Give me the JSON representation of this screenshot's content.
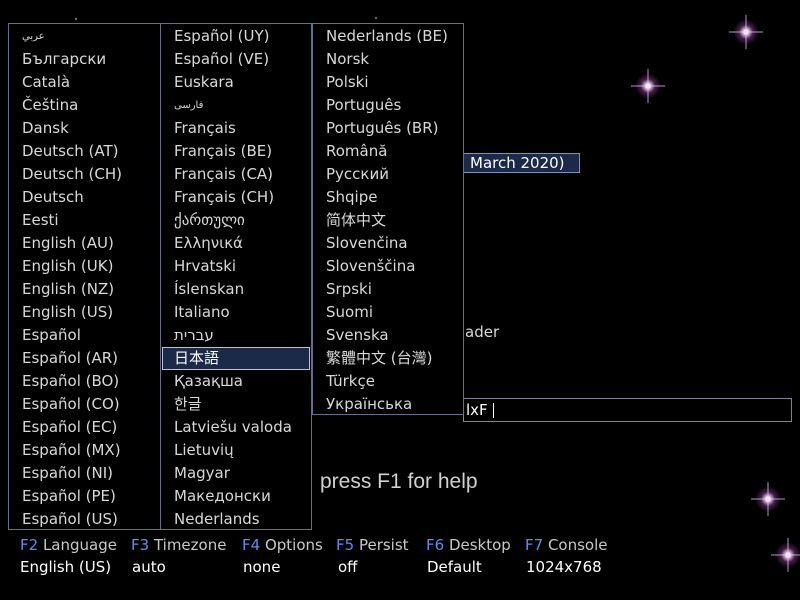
{
  "background": {
    "version_text": "March 2020)",
    "loader_fragment": "ader",
    "boot_options_fragment": "lxF",
    "help_text": "press F1 for help"
  },
  "language_menu": {
    "columns": [
      [
        "عربي",
        "Български",
        "Català",
        "Čeština",
        "Dansk",
        "Deutsch (AT)",
        "Deutsch (CH)",
        "Deutsch",
        "Eesti",
        "English (AU)",
        "English (UK)",
        "English (NZ)",
        "English (US)",
        "Español",
        "Español (AR)",
        "Español (BO)",
        "Español (CO)",
        "Español (EC)",
        "Español (MX)",
        "Español (NI)",
        "Español (PE)",
        "Español (US)"
      ],
      [
        "Español (UY)",
        "Español (VE)",
        "Euskara",
        "فارسی",
        "Français",
        "Français (BE)",
        "Français (CA)",
        "Français (CH)",
        "ქართული",
        "Ελληνικά",
        "Hrvatski",
        "Íslenskan",
        "Italiano",
        "עברית",
        "日本語",
        "Қазақша",
        "한글",
        "Latviešu valoda",
        "Lietuvių",
        "Magyar",
        "Македонски",
        "Nederlands"
      ],
      [
        "Nederlands (BE)",
        "Norsk",
        "Polski",
        "Português",
        "Português (BR)",
        "Română",
        "Русский",
        "Shqipe",
        "简体中文",
        "Slovenčina",
        "Slovenščina",
        "Srpski",
        "Suomi",
        "Svenska",
        "繁體中文 (台灣)",
        "Türkçe",
        "Українська"
      ]
    ],
    "selected": "日本語"
  },
  "function_keys": [
    {
      "key": "F2",
      "label": "Language",
      "value": "English (US)"
    },
    {
      "key": "F3",
      "label": "Timezone",
      "value": "auto"
    },
    {
      "key": "F4",
      "label": "Options",
      "value": "none"
    },
    {
      "key": "F5",
      "label": "Persist",
      "value": "off"
    },
    {
      "key": "F6",
      "label": "Desktop",
      "value": "Default"
    },
    {
      "key": "F7",
      "label": "Console",
      "value": "1024x768"
    }
  ],
  "colors": {
    "background": "#000000",
    "menu_border": "#5e6f96",
    "selection_bg": "#1b2a48",
    "fkey_accent": "#5b8ef0"
  }
}
